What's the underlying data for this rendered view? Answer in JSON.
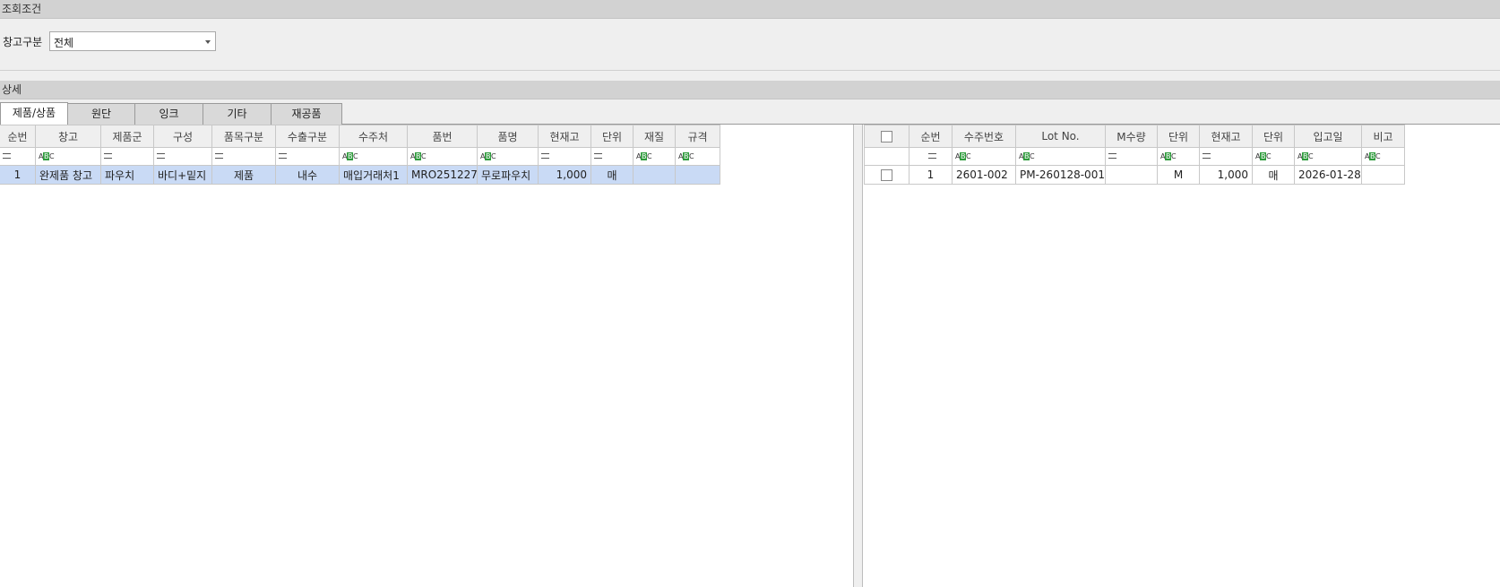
{
  "condition": {
    "title": "조회조건",
    "warehouse_label": "창고구분",
    "warehouse_value": "전체"
  },
  "detail": {
    "title": "상세",
    "tabs": [
      "제품/상품",
      "원단",
      "잉크",
      "기타",
      "재공품"
    ]
  },
  "left_grid": {
    "headers": [
      "순번",
      "창고",
      "제품군",
      "구성",
      "품목구분",
      "수출구분",
      "수주처",
      "품번",
      "품명",
      "현재고",
      "단위",
      "재질",
      "규격"
    ],
    "rows": [
      [
        "1",
        "완제품 창고",
        "파우치",
        "바디+밑지",
        "제품",
        "내수",
        "매입거래처1",
        "MRO251227",
        "무로파우치",
        "1,000",
        "매",
        "",
        ""
      ]
    ]
  },
  "right_grid": {
    "headers": [
      "순번",
      "수주번호",
      "Lot No.",
      "M수량",
      "단위",
      "현재고",
      "단위",
      "입고일",
      "비고"
    ],
    "rows": [
      [
        "1",
        "2601-002",
        "PM-260128-001",
        "",
        "M",
        "1,000",
        "매",
        "2026-01-28",
        ""
      ]
    ]
  },
  "filter_abc": "ABC"
}
